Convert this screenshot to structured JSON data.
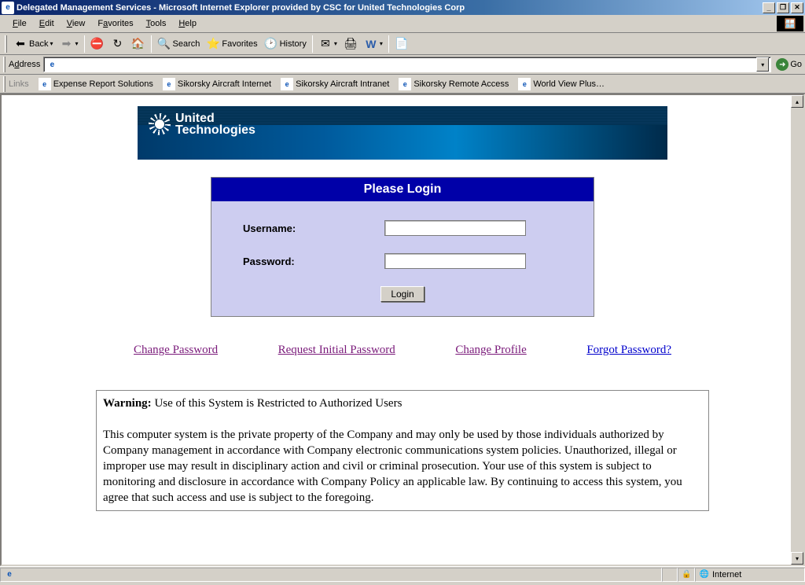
{
  "window": {
    "title": "Delegated Management Services - Microsoft Internet Explorer provided by CSC for United Technologies Corp"
  },
  "menu": {
    "items": [
      "File",
      "Edit",
      "View",
      "Favorites",
      "Tools",
      "Help"
    ]
  },
  "toolbar": {
    "back": "Back",
    "search": "Search",
    "favorites": "Favorites",
    "history": "History"
  },
  "address": {
    "label": "Address",
    "value": "",
    "go": "Go"
  },
  "linksbar": {
    "label": "Links",
    "items": [
      "Expense Report Solutions",
      "Sikorsky Aircraft Internet",
      "Sikorsky Aircraft Intranet",
      "Sikorsky Remote Access",
      "World View Plus…"
    ]
  },
  "banner": {
    "brand_line1": "United",
    "brand_line2": "Technologies"
  },
  "login": {
    "header": "Please Login",
    "username_label": "Username:",
    "password_label": "Password:",
    "button": "Login"
  },
  "actions": {
    "change_password": "Change Password",
    "request_initial": "Request Initial Password",
    "change_profile": "Change Profile",
    "forgot_password": "Forgot Password?"
  },
  "warning": {
    "bold": "Warning:",
    "line1": " Use of this System is Restricted to Authorized Users",
    "body": "This computer system is the private property of the Company and may only be used by those individuals authorized by Company management in accordance with Company electronic communications system policies. Unauthorized, illegal or improper use may result in disciplinary action and civil or criminal prosecution. Your use of this system is subject to monitoring and disclosure in accordance with Company Policy an applicable law. By continuing to access this system, you agree that such access and use is subject to the foregoing."
  },
  "status": {
    "zone": "Internet"
  }
}
